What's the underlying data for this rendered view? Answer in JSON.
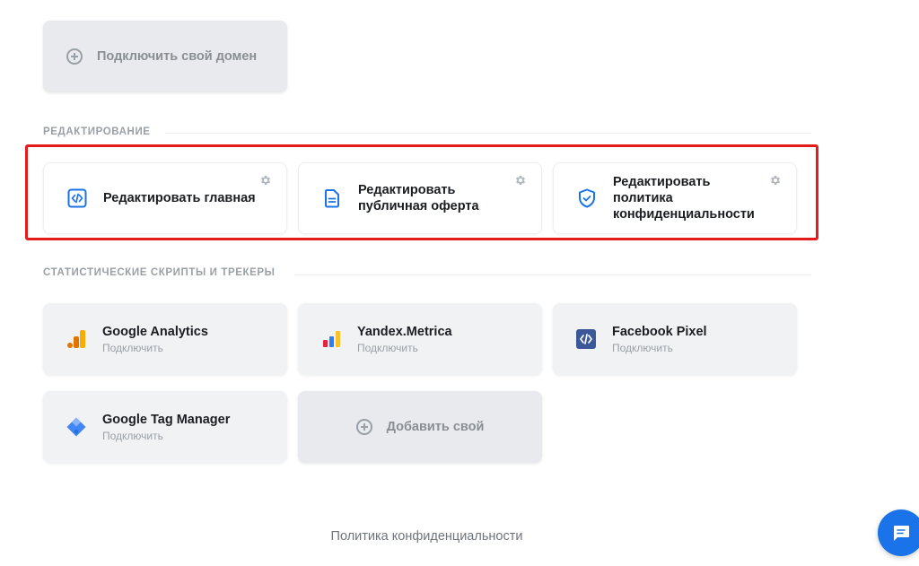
{
  "domain_card": {
    "label": "Подключить свой домен",
    "icon": "plus-circle-icon"
  },
  "editing": {
    "section_title": "РЕДАКТИРОВАНИЕ",
    "cards": [
      {
        "title": "Редактировать главная",
        "icon": "code-icon"
      },
      {
        "title": "Редактировать публичная оферта",
        "icon": "document-icon"
      },
      {
        "title": "Редактировать политика конфиденциальности",
        "icon": "shield-check-icon"
      }
    ]
  },
  "trackers": {
    "section_title": "СТАТИСТИЧЕСКИЕ СКРИПТЫ И ТРЕКЕРЫ",
    "cards": [
      {
        "title": "Google Analytics",
        "subtitle": "Подключить",
        "icon": "google-analytics-icon"
      },
      {
        "title": "Yandex.Metrica",
        "subtitle": "Подключить",
        "icon": "yandex-metrica-icon"
      },
      {
        "title": "Facebook Pixel",
        "subtitle": "Подключить",
        "icon": "facebook-pixel-icon"
      },
      {
        "title": "Google Tag Manager",
        "subtitle": "Подключить",
        "icon": "google-tag-manager-icon"
      }
    ],
    "add_label": "Добавить свой"
  },
  "footer": {
    "privacy_link": "Политика конфиденциальности"
  },
  "colors": {
    "accent": "#1a73e8",
    "highlight": "#e31b1b"
  }
}
